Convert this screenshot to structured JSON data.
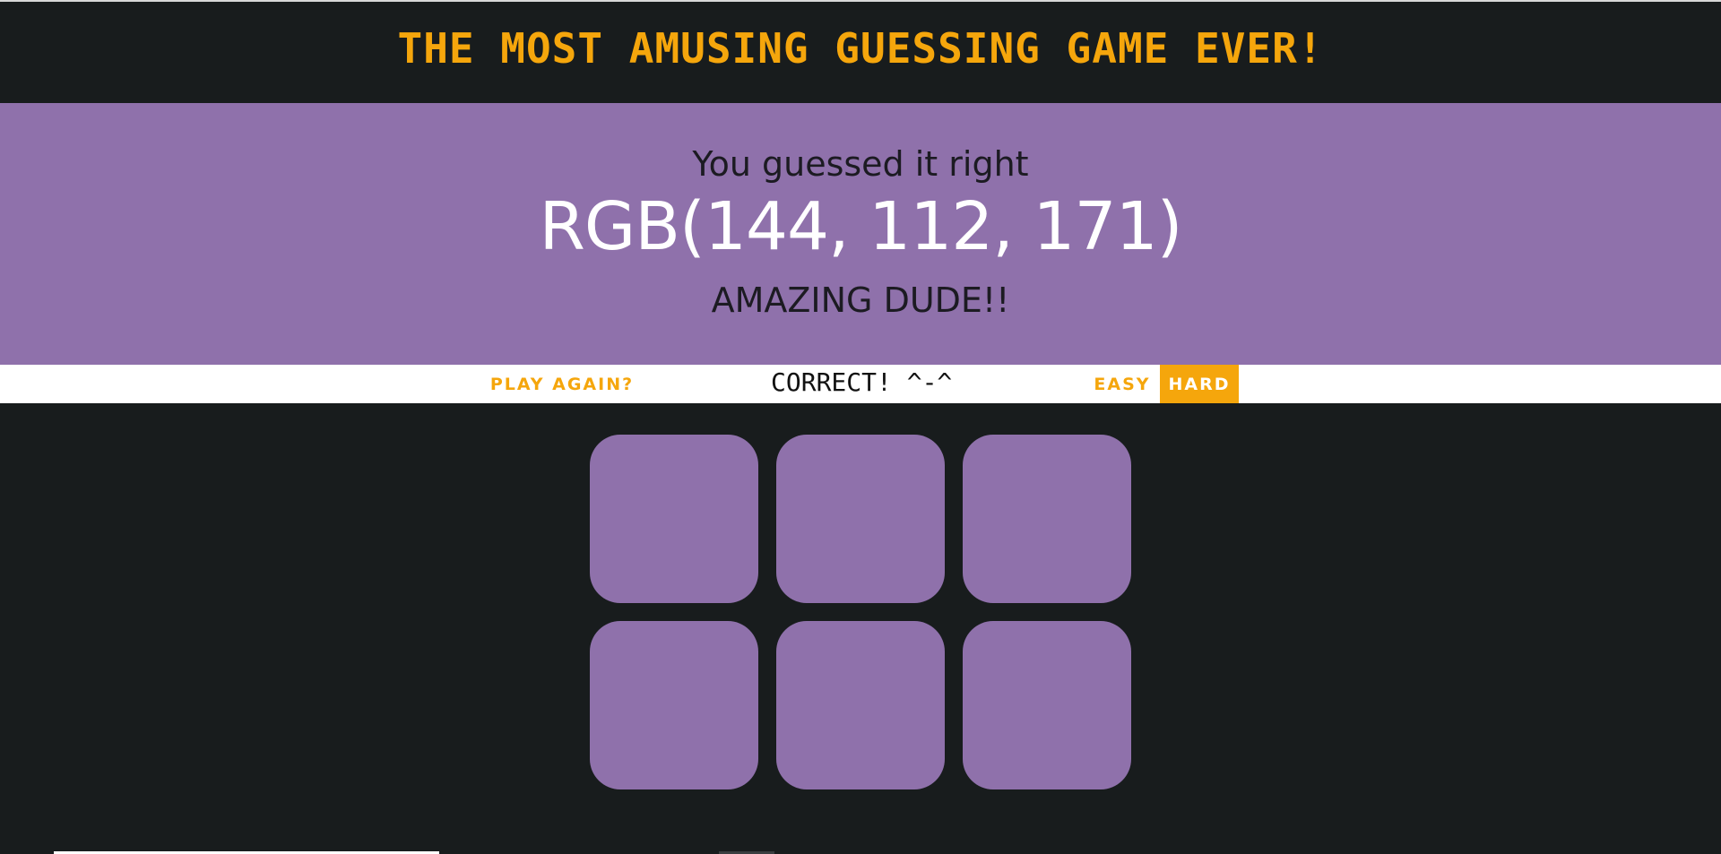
{
  "header": {
    "title": "THE MOST AMUSING GUESSING GAME EVER!"
  },
  "banner": {
    "message": "You guessed it right",
    "rgb_value": "RGB(144, 112, 171)",
    "praise": "AMAZING DUDE!!",
    "background_color": "#8f71ab"
  },
  "controls": {
    "play_again_label": "PLAY AGAIN?",
    "status": "CORRECT! ^-^",
    "easy_label": "EASY",
    "hard_label": "HARD",
    "selected_mode": "HARD"
  },
  "colors": {
    "accent": "#f5a60c",
    "page_background": "#181c1d"
  },
  "squares": [
    {
      "color": "#8f71ab"
    },
    {
      "color": "#8f71ab"
    },
    {
      "color": "#8f71ab"
    },
    {
      "color": "#8f71ab"
    },
    {
      "color": "#8f71ab"
    },
    {
      "color": "#8f71ab"
    }
  ]
}
